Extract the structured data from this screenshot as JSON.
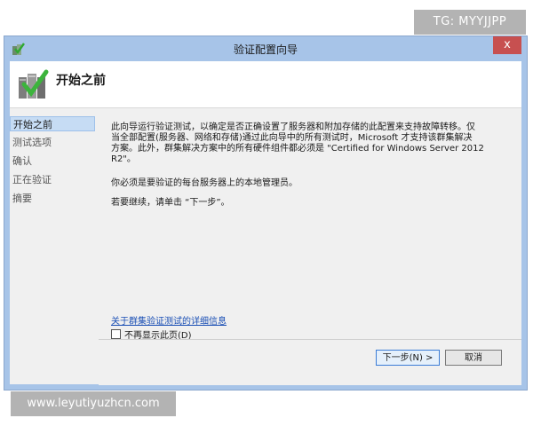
{
  "watermarks": {
    "top": "TG: MYYJJPP",
    "bottom": "www.leyutiyuzhcn.com"
  },
  "window": {
    "title": "验证配置向导",
    "close_glyph": "x"
  },
  "header": {
    "title": "开始之前",
    "icon": "cluster-check-icon"
  },
  "sidebar": {
    "items": [
      {
        "label": "开始之前",
        "active": true
      },
      {
        "label": "测试选项",
        "active": false
      },
      {
        "label": "确认",
        "active": false
      },
      {
        "label": "正在验证",
        "active": false
      },
      {
        "label": "摘要",
        "active": false
      }
    ]
  },
  "content": {
    "para1_line1": "此向导运行验证测试，以确定是否正确设置了服务器和附加存储的此配置来支持故障转移。仅",
    "para1_line2": "当全部配置(服务器、网络和存储)通过此向导中的所有测试时，Microsoft 才支持该群集解决",
    "para1_line3": "方案。此外，群集解决方案中的所有硬件组件都必须是 \"Certified for Windows Server 2012",
    "para1_line4": "R2\"。",
    "para2": "你必须是要验证的每台服务器上的本地管理员。",
    "para3": "若要继续，请单击 “下一步”。",
    "link": "关于群集验证测试的详细信息",
    "checkbox_label": "不再显示此页(D)",
    "checkbox_checked": false
  },
  "footer": {
    "next_label": "下一步(N) >",
    "cancel_label": "取消"
  }
}
